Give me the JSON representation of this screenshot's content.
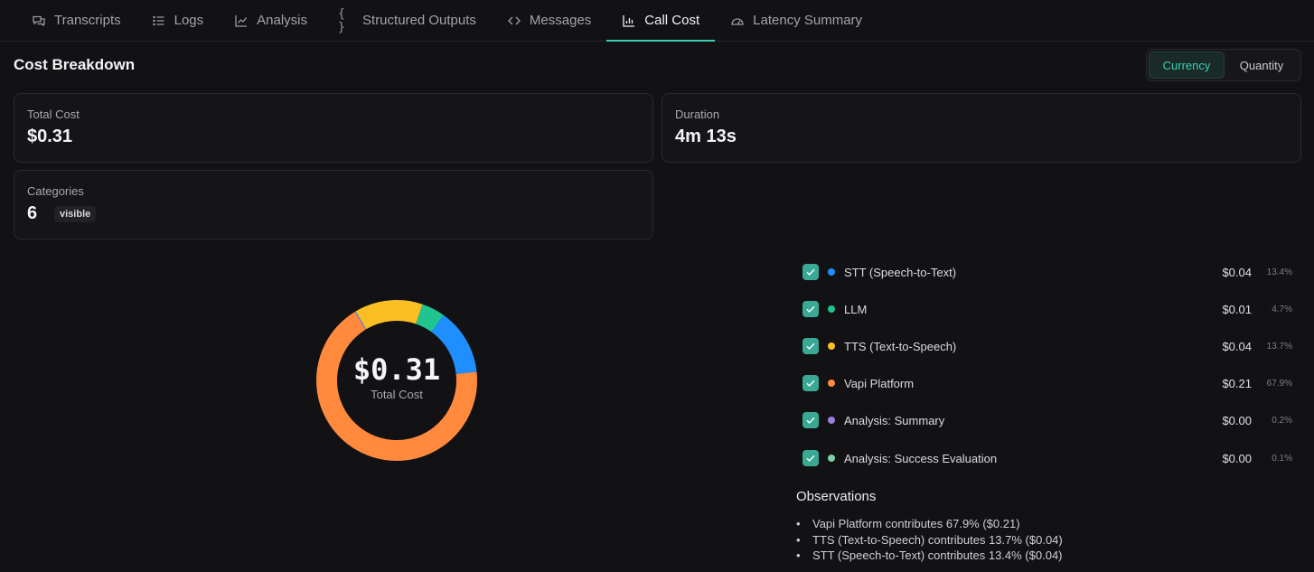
{
  "tabs": [
    {
      "label": "Transcripts",
      "icon": "chat-bubbles-icon"
    },
    {
      "label": "Logs",
      "icon": "list-icon"
    },
    {
      "label": "Analysis",
      "icon": "line-chart-icon"
    },
    {
      "label": "Structured Outputs",
      "icon": "braces-icon"
    },
    {
      "label": "Messages",
      "icon": "code-brackets-icon"
    },
    {
      "label": "Call Cost",
      "icon": "bar-chart-icon",
      "active": true
    },
    {
      "label": "Latency Summary",
      "icon": "gauge-icon"
    }
  ],
  "page_title": "Cost Breakdown",
  "toggle": {
    "currency": "Currency",
    "quantity": "Quantity",
    "selected": "Currency"
  },
  "cards": {
    "total_cost": {
      "label": "Total Cost",
      "value": "$0.31"
    },
    "duration": {
      "label": "Duration",
      "value": "4m 13s"
    },
    "categories": {
      "label": "Categories",
      "value": "6",
      "badge": "visible"
    }
  },
  "donut": {
    "value": "$0.31",
    "label": "Total Cost"
  },
  "chart_data": {
    "type": "pie",
    "categories": [
      "STT (Speech-to-Text)",
      "LLM",
      "TTS (Text-to-Speech)",
      "Vapi Platform",
      "Analysis: Summary",
      "Analysis: Success Evaluation"
    ],
    "values": [
      13.4,
      4.7,
      13.7,
      67.9,
      0.2,
      0.1
    ],
    "colors": [
      "#1f8fff",
      "#1fc48e",
      "#fbbf24",
      "#ff8a3d",
      "#9b7fe0",
      "#7fcfa7"
    ]
  },
  "legend": [
    {
      "name": "STT (Speech-to-Text)",
      "amount": "$0.04",
      "pct": "13.4%",
      "color": "#1f8fff"
    },
    {
      "name": "LLM",
      "amount": "$0.01",
      "pct": "4.7%",
      "color": "#1fc48e"
    },
    {
      "name": "TTS (Text-to-Speech)",
      "amount": "$0.04",
      "pct": "13.7%",
      "color": "#fbbf24"
    },
    {
      "name": "Vapi Platform",
      "amount": "$0.21",
      "pct": "67.9%",
      "color": "#ff8a3d"
    },
    {
      "name": "Analysis: Summary",
      "amount": "$0.00",
      "pct": "0.2%",
      "color": "#9b7fe0"
    },
    {
      "name": "Analysis: Success Evaluation",
      "amount": "$0.00",
      "pct": "0.1%",
      "color": "#7fcfa7"
    }
  ],
  "observations": {
    "title": "Observations",
    "items": [
      "Vapi Platform contributes 67.9% ($0.21)",
      "TTS (Text-to-Speech) contributes 13.7% ($0.04)",
      "STT (Speech-to-Text) contributes 13.4% ($0.04)"
    ]
  }
}
